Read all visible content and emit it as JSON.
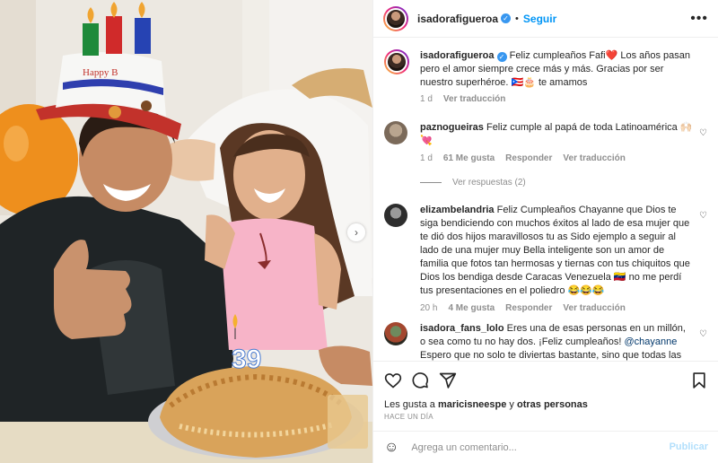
{
  "post_author": {
    "username": "isadorafigueroa",
    "follow_label": "Seguir",
    "more_icon": "more-horizontal-icon"
  },
  "caption": {
    "username": "isadorafigueroa",
    "text": "Feliz cumpleaños Fafi❤️ Los años pasan pero el amor siempre crece más y más. Gracias por ser nuestro superhéroe. 🇵🇷🎂 te amamos",
    "time": "1 d",
    "translate_label": "Ver traducción"
  },
  "comments": [
    {
      "username": "paznogueiras",
      "text": "Feliz cumple al papá de toda Latinoamérica 🙌🏻💘",
      "time": "1 d",
      "likes": "61 Me gusta",
      "reply_label": "Responder",
      "translate_label": "Ver traducción",
      "replies_label": "Ver respuestas (2)"
    },
    {
      "username": "elizambelandria",
      "text": "Feliz Cumpleaños Chayanne que Dios te siga bendiciendo con muchos éxitos al lado de esa mujer que te dió dos hijos maravillosos tu as Sido ejemplo a seguir al lado de una mujer muy Bella inteligente son un amor de familia que fotos tan hermosas y tiernas con tus chiquitos que Dios los bendiga desde Caracas Venezuela 🇻🇪 no me perdí tus presentaciones en el poliedro 😂😂😂",
      "time": "20 h",
      "likes": "4 Me gusta",
      "reply_label": "Responder",
      "translate_label": "Ver traducción"
    },
    {
      "username": "isadora_fans_lolo",
      "text_before": "Eres una de esas personas en un millón, o sea como tu no hay dos. ¡Feliz cumpleaños! ",
      "mention": "@chayanne",
      "text_after": " Espero que no solo te diviertas bastante, sino que todas las"
    }
  ],
  "likes": {
    "prefix": "Les gusta a ",
    "user": "maricisneespe",
    "middle": " y ",
    "others": "otras personas"
  },
  "timestamp": "HACE UN DÍA",
  "comment_box": {
    "placeholder": "Agrega un comentario...",
    "publish_label": "Publicar"
  },
  "photo": {
    "candle_number": "39",
    "hat_text": "Happy B"
  },
  "colors": {
    "link_blue": "#0095f6",
    "publish_disabled": "#b2dffc",
    "muted": "#8e8e8e",
    "verified": "#3897f0"
  }
}
